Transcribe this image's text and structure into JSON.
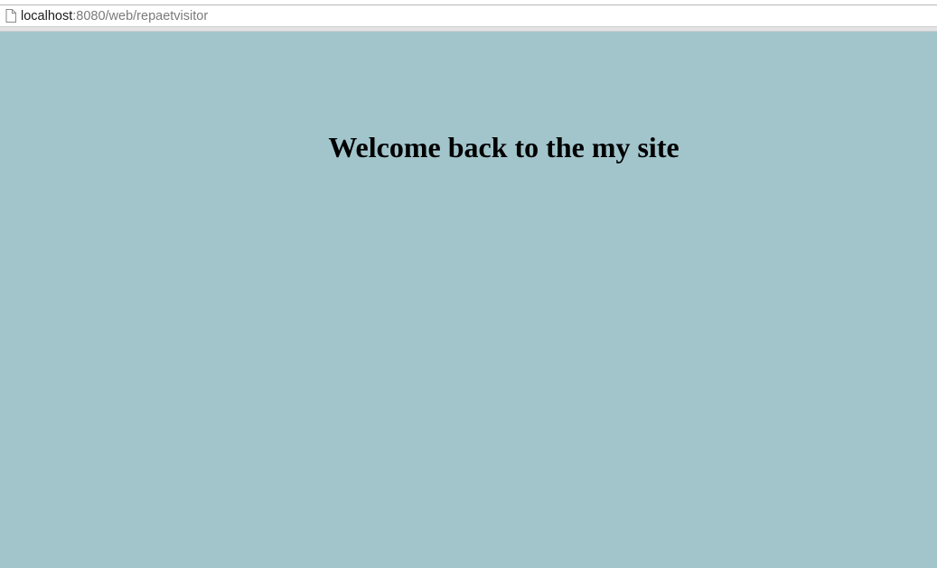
{
  "browser": {
    "address_bar": {
      "host": "localhost",
      "path": ":8080/web/repaetvisitor",
      "page_icon": "document-icon"
    }
  },
  "page": {
    "heading": "Welcome back to the my site",
    "background_color": "#a2c5cc"
  }
}
